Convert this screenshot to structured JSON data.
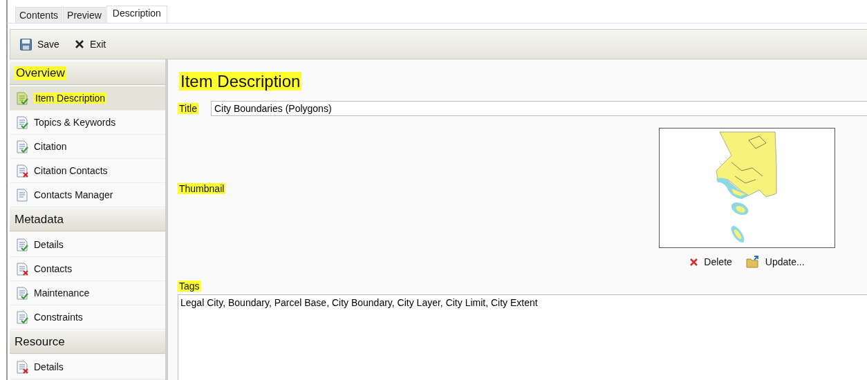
{
  "tabs": [
    {
      "label": "Contents",
      "selected": false
    },
    {
      "label": "Preview",
      "selected": false
    },
    {
      "label": "Description",
      "selected": true
    }
  ],
  "toolbar": [
    {
      "label": "Save",
      "kind": "save"
    },
    {
      "label": "Exit",
      "kind": "exit"
    }
  ],
  "sidebar": [
    {
      "title": "Overview",
      "highlighted": true,
      "items": [
        {
          "label": "Item Description",
          "kind": "complete",
          "selected": true,
          "highlighted": true
        },
        {
          "label": "Topics & Keywords",
          "kind": "complete",
          "selected": false,
          "highlighted": false
        },
        {
          "label": "Citation",
          "kind": "complete",
          "selected": false,
          "highlighted": false
        },
        {
          "label": "Citation Contacts",
          "kind": "incomplete",
          "selected": false,
          "highlighted": false
        },
        {
          "label": "Contacts Manager",
          "kind": "plain",
          "selected": false,
          "highlighted": false
        }
      ]
    },
    {
      "title": "Metadata",
      "highlighted": false,
      "items": [
        {
          "label": "Details",
          "kind": "complete",
          "selected": false,
          "highlighted": false
        },
        {
          "label": "Contacts",
          "kind": "incomplete",
          "selected": false,
          "highlighted": false
        },
        {
          "label": "Maintenance",
          "kind": "complete",
          "selected": false,
          "highlighted": false
        },
        {
          "label": "Constraints",
          "kind": "complete",
          "selected": false,
          "highlighted": false
        }
      ]
    },
    {
      "title": "Resource",
      "highlighted": false,
      "items": [
        {
          "label": "Details",
          "kind": "incomplete",
          "selected": false,
          "highlighted": false
        }
      ]
    }
  ],
  "main": {
    "heading": {
      "text": "Item Description",
      "highlighted": true
    },
    "title_field": {
      "label": "Title",
      "highlighted": true,
      "value": "City Boundaries (Polygons)"
    },
    "thumbnail": {
      "label": "Thumbnail",
      "highlighted": true,
      "buttons": [
        {
          "label": "Delete",
          "kind": "delete"
        },
        {
          "label": "Update...",
          "kind": "update"
        }
      ]
    },
    "tags": {
      "label": "Tags",
      "highlighted": true,
      "value": "Legal City, Boundary, Parcel Base, City Boundary, City Layer, City Limit, City Extent"
    }
  }
}
